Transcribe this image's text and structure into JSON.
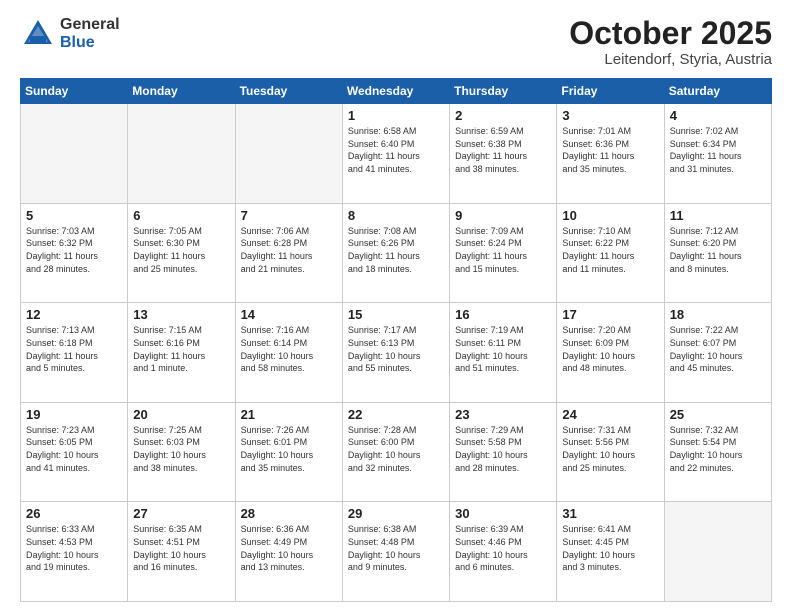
{
  "header": {
    "logo": {
      "general": "General",
      "blue": "Blue"
    },
    "title": "October 2025",
    "location": "Leitendorf, Styria, Austria"
  },
  "weekdays": [
    "Sunday",
    "Monday",
    "Tuesday",
    "Wednesday",
    "Thursday",
    "Friday",
    "Saturday"
  ],
  "weeks": [
    [
      {
        "day": "",
        "info": ""
      },
      {
        "day": "",
        "info": ""
      },
      {
        "day": "",
        "info": ""
      },
      {
        "day": "1",
        "info": "Sunrise: 6:58 AM\nSunset: 6:40 PM\nDaylight: 11 hours\nand 41 minutes."
      },
      {
        "day": "2",
        "info": "Sunrise: 6:59 AM\nSunset: 6:38 PM\nDaylight: 11 hours\nand 38 minutes."
      },
      {
        "day": "3",
        "info": "Sunrise: 7:01 AM\nSunset: 6:36 PM\nDaylight: 11 hours\nand 35 minutes."
      },
      {
        "day": "4",
        "info": "Sunrise: 7:02 AM\nSunset: 6:34 PM\nDaylight: 11 hours\nand 31 minutes."
      }
    ],
    [
      {
        "day": "5",
        "info": "Sunrise: 7:03 AM\nSunset: 6:32 PM\nDaylight: 11 hours\nand 28 minutes."
      },
      {
        "day": "6",
        "info": "Sunrise: 7:05 AM\nSunset: 6:30 PM\nDaylight: 11 hours\nand 25 minutes."
      },
      {
        "day": "7",
        "info": "Sunrise: 7:06 AM\nSunset: 6:28 PM\nDaylight: 11 hours\nand 21 minutes."
      },
      {
        "day": "8",
        "info": "Sunrise: 7:08 AM\nSunset: 6:26 PM\nDaylight: 11 hours\nand 18 minutes."
      },
      {
        "day": "9",
        "info": "Sunrise: 7:09 AM\nSunset: 6:24 PM\nDaylight: 11 hours\nand 15 minutes."
      },
      {
        "day": "10",
        "info": "Sunrise: 7:10 AM\nSunset: 6:22 PM\nDaylight: 11 hours\nand 11 minutes."
      },
      {
        "day": "11",
        "info": "Sunrise: 7:12 AM\nSunset: 6:20 PM\nDaylight: 11 hours\nand 8 minutes."
      }
    ],
    [
      {
        "day": "12",
        "info": "Sunrise: 7:13 AM\nSunset: 6:18 PM\nDaylight: 11 hours\nand 5 minutes."
      },
      {
        "day": "13",
        "info": "Sunrise: 7:15 AM\nSunset: 6:16 PM\nDaylight: 11 hours\nand 1 minute."
      },
      {
        "day": "14",
        "info": "Sunrise: 7:16 AM\nSunset: 6:14 PM\nDaylight: 10 hours\nand 58 minutes."
      },
      {
        "day": "15",
        "info": "Sunrise: 7:17 AM\nSunset: 6:13 PM\nDaylight: 10 hours\nand 55 minutes."
      },
      {
        "day": "16",
        "info": "Sunrise: 7:19 AM\nSunset: 6:11 PM\nDaylight: 10 hours\nand 51 minutes."
      },
      {
        "day": "17",
        "info": "Sunrise: 7:20 AM\nSunset: 6:09 PM\nDaylight: 10 hours\nand 48 minutes."
      },
      {
        "day": "18",
        "info": "Sunrise: 7:22 AM\nSunset: 6:07 PM\nDaylight: 10 hours\nand 45 minutes."
      }
    ],
    [
      {
        "day": "19",
        "info": "Sunrise: 7:23 AM\nSunset: 6:05 PM\nDaylight: 10 hours\nand 41 minutes."
      },
      {
        "day": "20",
        "info": "Sunrise: 7:25 AM\nSunset: 6:03 PM\nDaylight: 10 hours\nand 38 minutes."
      },
      {
        "day": "21",
        "info": "Sunrise: 7:26 AM\nSunset: 6:01 PM\nDaylight: 10 hours\nand 35 minutes."
      },
      {
        "day": "22",
        "info": "Sunrise: 7:28 AM\nSunset: 6:00 PM\nDaylight: 10 hours\nand 32 minutes."
      },
      {
        "day": "23",
        "info": "Sunrise: 7:29 AM\nSunset: 5:58 PM\nDaylight: 10 hours\nand 28 minutes."
      },
      {
        "day": "24",
        "info": "Sunrise: 7:31 AM\nSunset: 5:56 PM\nDaylight: 10 hours\nand 25 minutes."
      },
      {
        "day": "25",
        "info": "Sunrise: 7:32 AM\nSunset: 5:54 PM\nDaylight: 10 hours\nand 22 minutes."
      }
    ],
    [
      {
        "day": "26",
        "info": "Sunrise: 6:33 AM\nSunset: 4:53 PM\nDaylight: 10 hours\nand 19 minutes."
      },
      {
        "day": "27",
        "info": "Sunrise: 6:35 AM\nSunset: 4:51 PM\nDaylight: 10 hours\nand 16 minutes."
      },
      {
        "day": "28",
        "info": "Sunrise: 6:36 AM\nSunset: 4:49 PM\nDaylight: 10 hours\nand 13 minutes."
      },
      {
        "day": "29",
        "info": "Sunrise: 6:38 AM\nSunset: 4:48 PM\nDaylight: 10 hours\nand 9 minutes."
      },
      {
        "day": "30",
        "info": "Sunrise: 6:39 AM\nSunset: 4:46 PM\nDaylight: 10 hours\nand 6 minutes."
      },
      {
        "day": "31",
        "info": "Sunrise: 6:41 AM\nSunset: 4:45 PM\nDaylight: 10 hours\nand 3 minutes."
      },
      {
        "day": "",
        "info": ""
      }
    ]
  ]
}
